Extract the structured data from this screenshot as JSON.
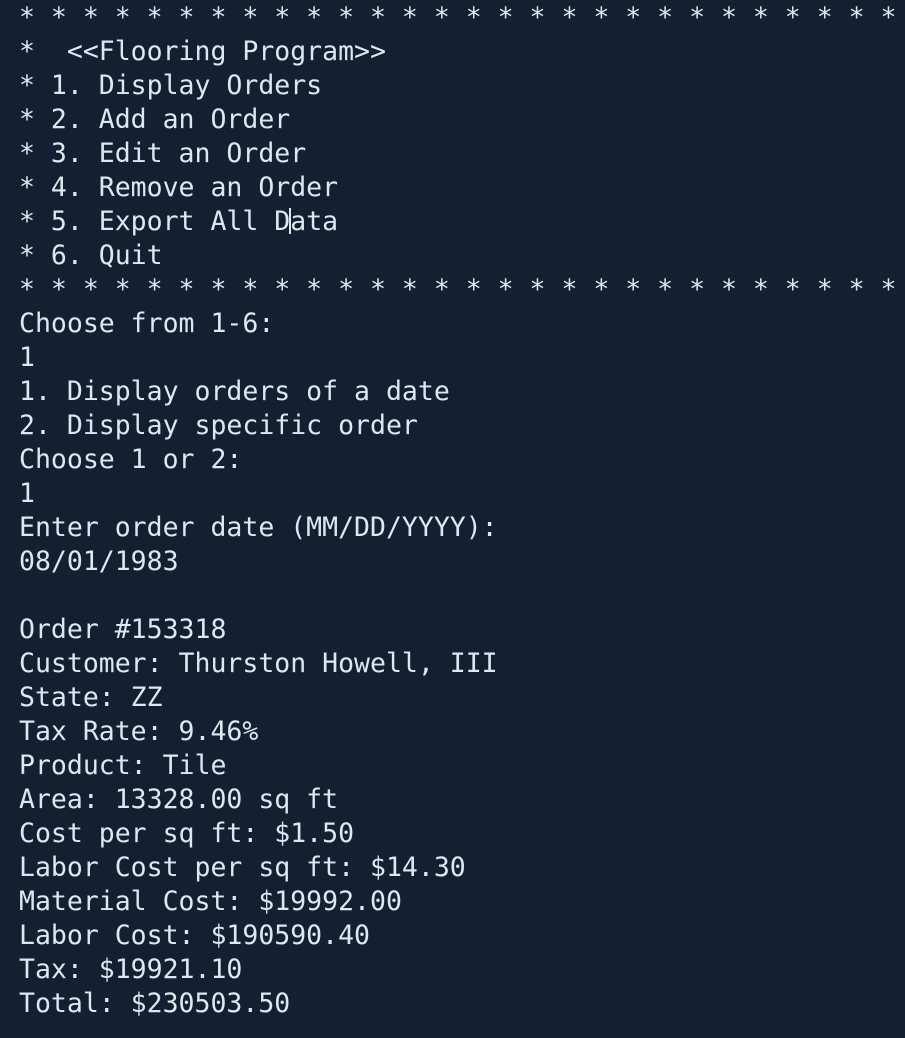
{
  "terminal": {
    "menu": {
      "border": "* * * * * * * * * * * * * * * * * * * * * * * * * * * * *",
      "title": "*  <<Flooring Program>>",
      "options": [
        "* 1. Display Orders",
        "* 2. Add an Order",
        "* 3. Edit an Order",
        "* 4. Remove an Order",
        "* 6. Quit"
      ],
      "option5_before_caret": "* 5. Export All D",
      "option5_after_caret": "ata"
    },
    "prompts": {
      "choose_main": "Choose from 1-6:",
      "choose_main_input": "1",
      "sub_option_1": "1. Display orders of a date",
      "sub_option_2": "2. Display specific order",
      "choose_sub": "Choose 1 or 2:",
      "choose_sub_input": "1",
      "enter_date": "Enter order date (MM/DD/YYYY):",
      "date_input": "08/01/1983"
    },
    "order": {
      "number": "Order #153318",
      "customer": "Customer: Thurston Howell, III",
      "state": "State: ZZ",
      "tax_rate": "Tax Rate: 9.46%",
      "product": "Product: Tile",
      "area": "Area: 13328.00 sq ft",
      "cost_per_sqft": "Cost per sq ft: $1.50",
      "labor_cost_per_sqft": "Labor Cost per sq ft: $14.30",
      "material_cost": "Material Cost: $19992.00",
      "labor_cost": "Labor Cost: $190590.40",
      "tax": "Tax: $19921.10",
      "total": "Total: $230503.50"
    }
  }
}
